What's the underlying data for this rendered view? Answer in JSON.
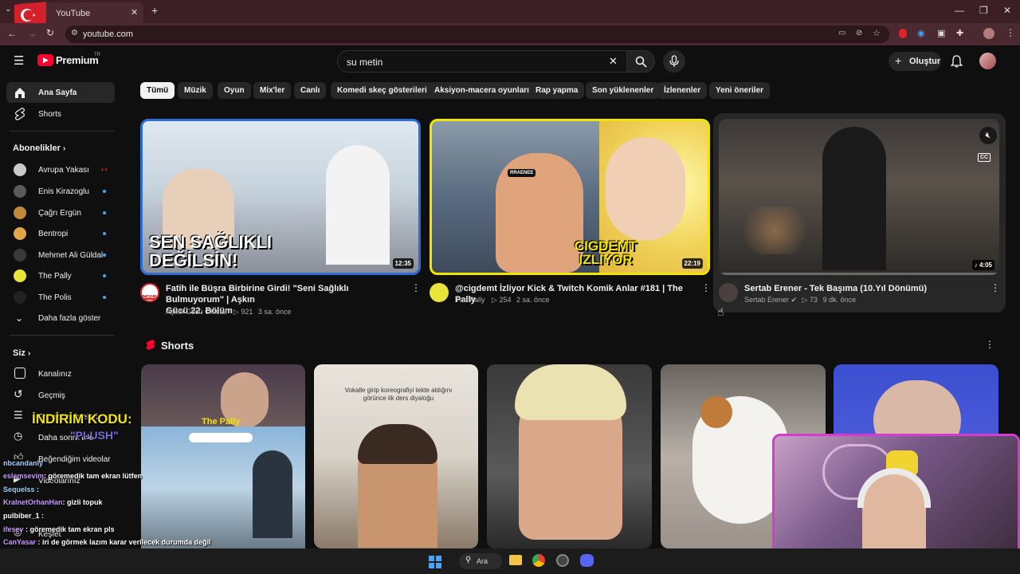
{
  "browser": {
    "tab_title": "YouTube",
    "url": "youtube.com"
  },
  "header": {
    "logo_text": "Premium",
    "logo_badge": "TR",
    "search_value": "su metin",
    "create_label": "Oluştur"
  },
  "sidebar": {
    "main": [
      {
        "label": "Ana Sayfa",
        "icon": "home-icon"
      },
      {
        "label": "Shorts",
        "icon": "shorts-icon"
      }
    ],
    "subs_heading": "Abonelikler",
    "subscriptions": [
      {
        "label": "Avrupa Yakası",
        "color": "#c9c9c9",
        "badge": "live"
      },
      {
        "label": "Enis Kirazoglu",
        "color": "#5a5a5a",
        "badge": "dot"
      },
      {
        "label": "Çağrı Ergün",
        "color": "#c08a3a",
        "badge": "dot"
      },
      {
        "label": "Bentropi",
        "color": "#e0a64a",
        "badge": "dot"
      },
      {
        "label": "Mehmet Ali Güldal",
        "color": "#3a3a3a",
        "badge": "dot"
      },
      {
        "label": "The Pally",
        "color": "#e8e43a",
        "badge": "dot"
      },
      {
        "label": "The Polis",
        "color": "#222222",
        "badge": "dot"
      }
    ],
    "show_more": "Daha fazla göster",
    "you_heading": "Siz",
    "you_items": [
      {
        "label": "Kanalınız",
        "icon": "channel-icon"
      },
      {
        "label": "Geçmiş",
        "icon": "history-icon"
      },
      {
        "label": "Oynatma listeleri",
        "icon": "playlist-icon"
      },
      {
        "label": "Daha sonra izle",
        "icon": "clock-icon"
      },
      {
        "label": "Beğendiğim videolar",
        "icon": "like-icon"
      },
      {
        "label": "Videolarınız",
        "icon": "video-icon"
      },
      {
        "label": "Keşfet",
        "icon": "compass-icon"
      }
    ]
  },
  "chips": [
    "Tümü",
    "Müzik",
    "Oyun",
    "Mix'ler",
    "Canlı",
    "Komedi skeç gösterileri",
    "Aksiyon-macera oyunları",
    "Rap yapma",
    "Son yüklenenler",
    "İzlenenler",
    "Yeni öneriler"
  ],
  "videos": [
    {
      "title_line1": "Fatih ile Büşra Birbirine Girdi! \"Seni Sağlıklı Bulmuyorum\" | Aşkın",
      "title_line2": "Gücü 22. Bölüm",
      "channel": "Aşkın Gücü Official",
      "views": "921",
      "age": "3 sa. önce",
      "duration": "12:35",
      "thumb_text": "SEN SAĞLIKLI DEĞİLSİN!",
      "accent": "#2d6bd6"
    },
    {
      "title_line1": "@cigdemt İzliyor Kick & Twitch Komik Anlar #181 | The Pally",
      "title_line2": "",
      "channel": "The Pally",
      "views": "254",
      "age": "2 sa. önce",
      "duration": "22:19",
      "thumb_text": "CIGDEMT IZLIYOR",
      "accent": "#f2e600"
    },
    {
      "title_line1": "Sertab Erener - Tek Başıma (10.Yıl Dönümü)",
      "title_line2": "",
      "channel": "Sertab Erener",
      "views": "73",
      "age": "9 dk. önce",
      "duration": "4:05",
      "thumb_text": "",
      "accent": "#3a3434"
    }
  ],
  "shorts_heading": "Shorts",
  "shorts_texts": [
    "The Pally",
    "Vokalle girip koreografiyi tekte aldığını görünce ilk ders diyaloğu"
  ],
  "overlay": {
    "promo_line1": "İNDİRİM KODU:",
    "promo_line2": "\"PLUSH\"",
    "chat": [
      {
        "user": "nbcandanly",
        "text": ""
      },
      {
        "user": "eslemsevim",
        "text": ": göremedik tam ekran lütfen"
      },
      {
        "user": "Sequelss",
        "text": ":"
      },
      {
        "user": "KralnetOrhanHan",
        "text": ": gizli topuk"
      },
      {
        "user": "pulbiber_1",
        "text": ":"
      },
      {
        "user": "ifesev",
        "text": ": göremedik tam ekran pls"
      },
      {
        "user": "CanYasar",
        "text": ": iri de görmek lazım karar verilecek durumda değil"
      },
      {
        "user": "ifesev",
        "text": ":"
      }
    ],
    "taskbar_search": "Ara"
  }
}
